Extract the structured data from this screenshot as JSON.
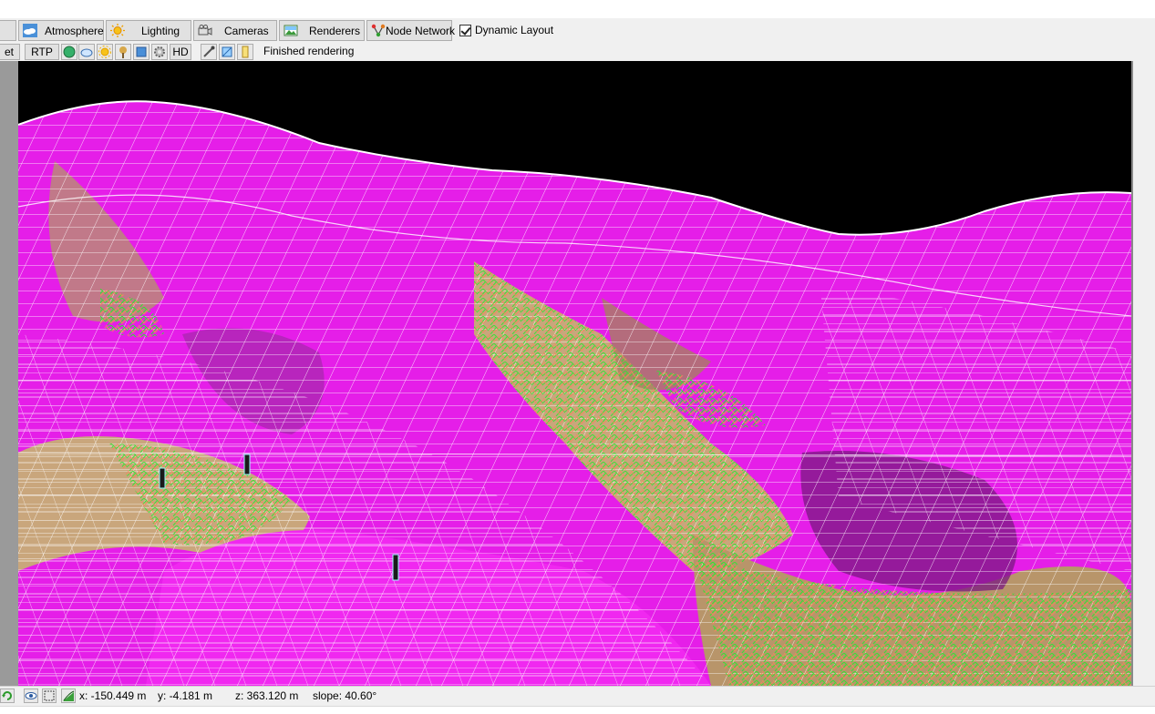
{
  "tabs": [
    {
      "label": "Atmosphere",
      "icon": "cloud-sky-icon"
    },
    {
      "label": "Lighting",
      "icon": "sun-icon"
    },
    {
      "label": "Cameras",
      "icon": "camera-icon"
    },
    {
      "label": "Renderers",
      "icon": "render-image-icon"
    },
    {
      "label": "Node Network",
      "icon": "node-network-icon"
    }
  ],
  "dynamic_layout": {
    "label": "Dynamic Layout",
    "checked": true
  },
  "toolbar": {
    "partial_label": "et",
    "rtp_label": "RTP",
    "hd_label": "HD",
    "status": "Finished rendering"
  },
  "statusbar": {
    "x": "x: -150.449 m",
    "y": "y: -4.181 m",
    "z": "z: 363.120 m",
    "slope": "slope: 40.60°"
  },
  "colors": {
    "terrain_magenta": "#e51ee8",
    "terrain_tan": "#c9a67c",
    "wire_white": "#ffffff",
    "wire_green": "#32e432",
    "wire_orange": "#f08a5a",
    "sky": "#000000"
  }
}
